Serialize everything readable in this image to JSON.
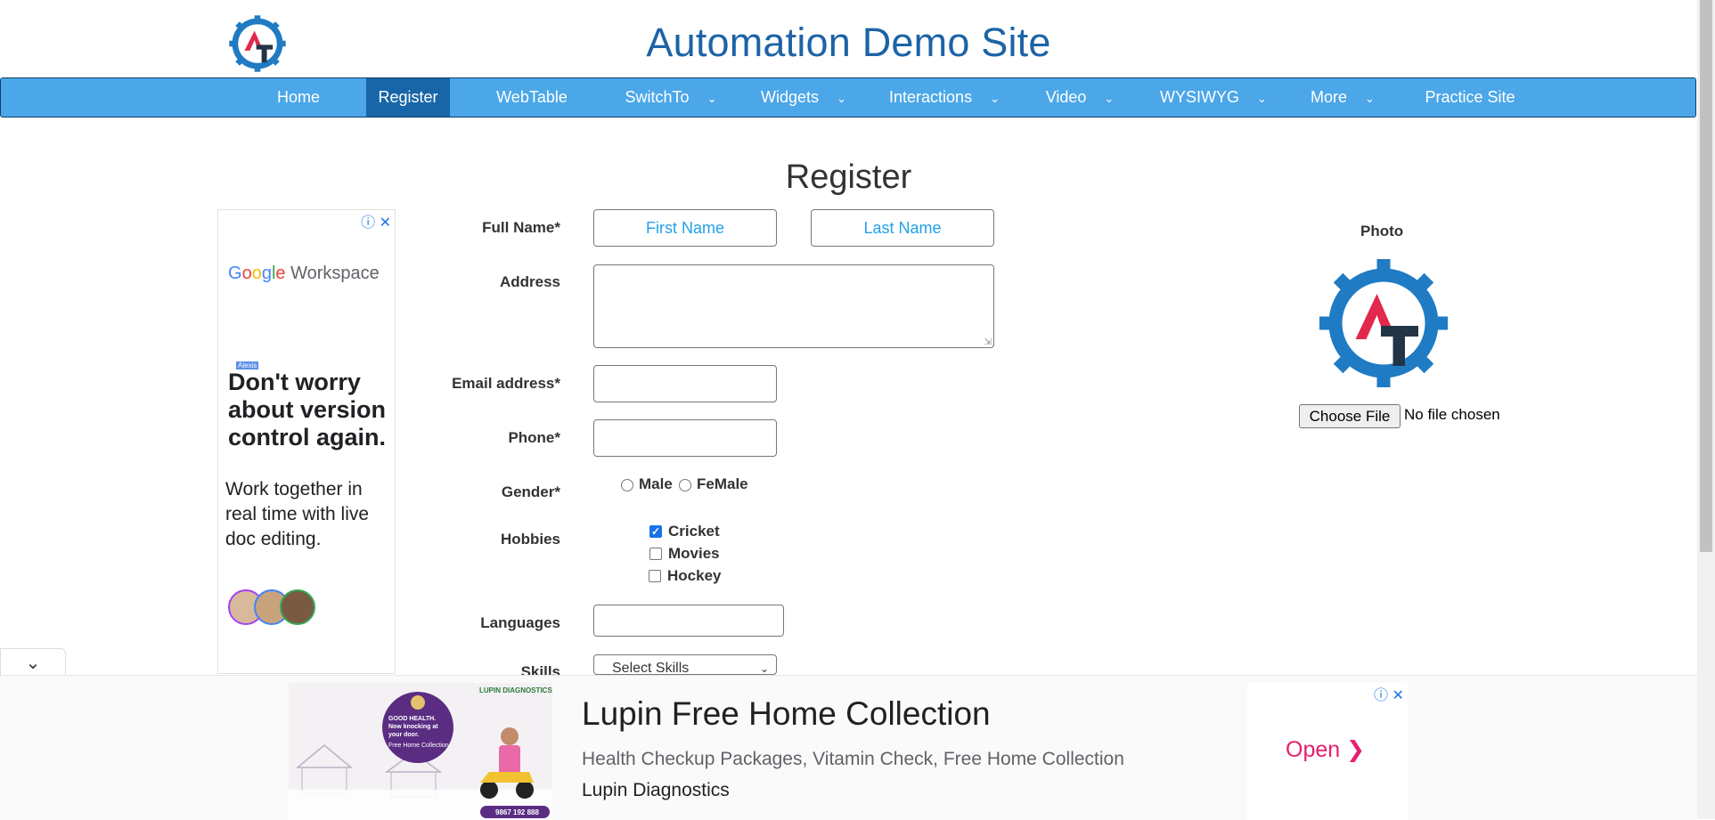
{
  "header": {
    "title": "Automation Demo Site"
  },
  "nav": {
    "items": [
      {
        "label": "Home",
        "dropdown": false
      },
      {
        "label": "Register",
        "dropdown": false,
        "active": true
      },
      {
        "label": "WebTable",
        "dropdown": false
      },
      {
        "label": "SwitchTo",
        "dropdown": true
      },
      {
        "label": "Widgets",
        "dropdown": true
      },
      {
        "label": "Interactions",
        "dropdown": true
      },
      {
        "label": "Video",
        "dropdown": true
      },
      {
        "label": "WYSIWYG",
        "dropdown": true
      },
      {
        "label": "More",
        "dropdown": true
      },
      {
        "label": "Practice Site",
        "dropdown": false
      }
    ],
    "chevron": "⌄"
  },
  "page": {
    "title": "Register"
  },
  "form": {
    "full_name_label": "Full Name*",
    "first_name_placeholder": "First Name",
    "last_name_placeholder": "Last Name",
    "address_label": "Address",
    "email_label": "Email address*",
    "phone_label": "Phone*",
    "gender_label": "Gender*",
    "gender_options": [
      "Male",
      "FeMale"
    ],
    "hobbies_label": "Hobbies",
    "hobbies": [
      {
        "label": "Cricket",
        "checked": true
      },
      {
        "label": "Movies",
        "checked": false
      },
      {
        "label": "Hockey",
        "checked": false
      }
    ],
    "languages_label": "Languages",
    "skills_label": "Skills",
    "skills_selected": "Select Skills"
  },
  "photo": {
    "label": "Photo",
    "choose_file": "Choose File",
    "no_file": "No file chosen"
  },
  "left_ad": {
    "brand": "Google Workspace",
    "tag": "Alexis",
    "headline": "Don't worry about version control again.",
    "body": "Work together in real time with live doc editing."
  },
  "bottom_ad": {
    "title": "Lupin Free Home Collection",
    "description": "Health Checkup Packages, Vitamin Check, Free Home Collection",
    "advertiser": "Lupin Diagnostics",
    "cta": "Open",
    "image_brand": "LUPIN DIAGNOSTICS",
    "image_headline": "GOOD HEALTH. Now knocking at your door.",
    "image_sub": "Free Home Collection",
    "image_phone": "9867 192 888"
  },
  "colors": {
    "nav_bg": "#4ba7e8",
    "nav_active": "#1866a8",
    "title": "#1d63a6",
    "placeholder": "#22a1e8",
    "cta": "#e51e6e"
  }
}
